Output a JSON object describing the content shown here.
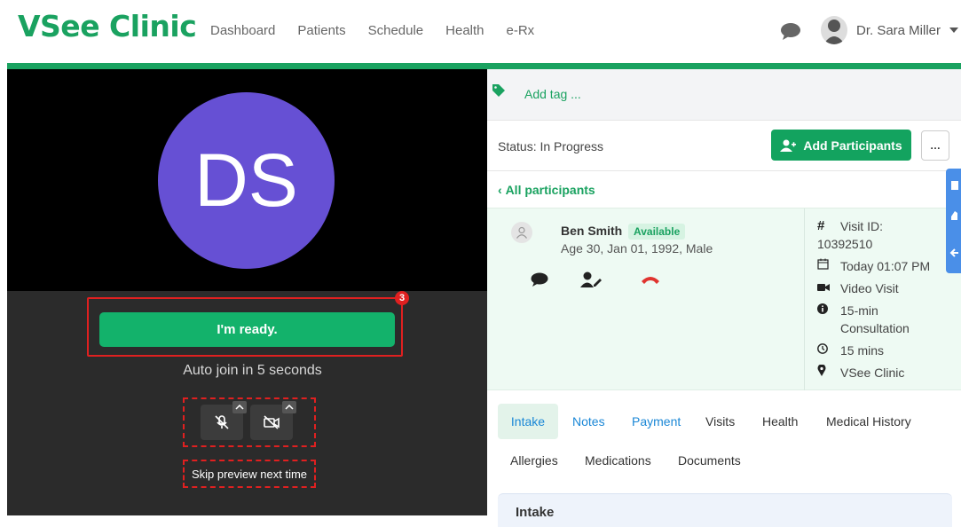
{
  "header": {
    "logo": "VSee Clinic",
    "nav": [
      "Dashboard",
      "Patients",
      "Schedule",
      "Health",
      "e-Rx"
    ],
    "user_name": "Dr. Sara Miller"
  },
  "video": {
    "initials": "DS",
    "ready_label": "I'm ready.",
    "badge_count": "3",
    "auto_join": "Auto join in 5 seconds",
    "skip_preview": "Skip preview next time"
  },
  "right": {
    "add_tag": "Add tag ...",
    "status": "Status: In Progress",
    "add_participants": "Add Participants",
    "more_label": "…",
    "all_participants": "All participants",
    "patient": {
      "name": "Ben Smith",
      "availability": "Available",
      "info": "Age 30, Jan 01, 1992, Male"
    },
    "visit": {
      "visit_id_label": "Visit ID:",
      "visit_id": "10392510",
      "time": "Today 01:07 PM",
      "type": "Video Visit",
      "consultation": "15-min Consultation",
      "duration": "15 mins",
      "clinic": "VSee Clinic"
    },
    "tabs": [
      "Intake",
      "Notes",
      "Payment",
      "Visits",
      "Health",
      "Medical History",
      "Allergies",
      "Medications",
      "Documents"
    ],
    "section_title": "Intake"
  },
  "colors": {
    "brand_green": "#1aa260",
    "button_green": "#13b26b",
    "avatar_purple": "#6650d4",
    "alert_red": "#e02020",
    "link_blue": "#1a87d6"
  }
}
